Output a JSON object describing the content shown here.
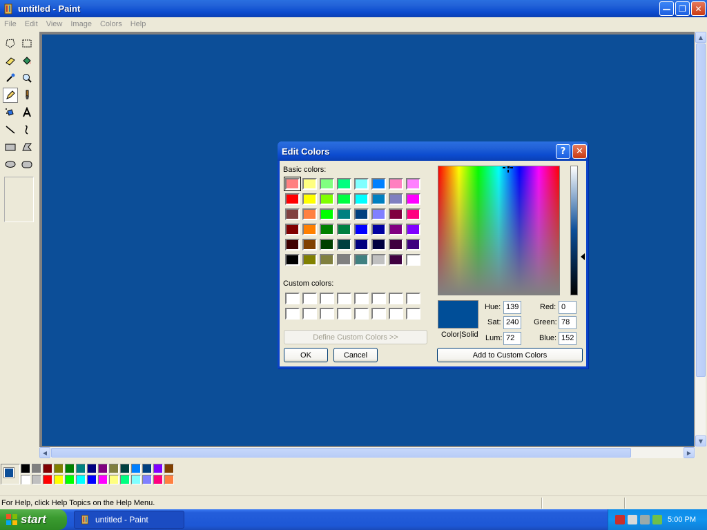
{
  "window": {
    "title": "untitled - Paint"
  },
  "menu": [
    "File",
    "Edit",
    "View",
    "Image",
    "Colors",
    "Help"
  ],
  "status": {
    "text": "For Help, click Help Topics on the Help Menu."
  },
  "taskbar": {
    "start_label": "start",
    "task_label": "untitled - Paint",
    "clock": "5:00 PM"
  },
  "palette": {
    "foreground": "#0c4e98",
    "background": "#ffffff",
    "row1": [
      "#000000",
      "#808080",
      "#800000",
      "#808000",
      "#008000",
      "#008080",
      "#000080",
      "#800080",
      "#808040",
      "#004040",
      "#0080ff",
      "#004080",
      "#8000ff",
      "#804000"
    ],
    "row2": [
      "#ffffff",
      "#c0c0c0",
      "#ff0000",
      "#ffff00",
      "#00ff00",
      "#00ffff",
      "#0000ff",
      "#ff00ff",
      "#ffff80",
      "#00ff80",
      "#80ffff",
      "#8080ff",
      "#ff0080",
      "#ff8040"
    ]
  },
  "dialog": {
    "title": "Edit Colors",
    "basic_label": "Basic colors:",
    "custom_label": "Custom colors:",
    "define_button": "Define Custom Colors >>",
    "ok": "OK",
    "cancel": "Cancel",
    "add_button": "Add to Custom Colors",
    "preview_label": "Color|Solid",
    "hue_label": "Hue:",
    "hue": "139",
    "sat_label": "Sat:",
    "sat": "240",
    "lum_label": "Lum:",
    "lum": "72",
    "red_label": "Red:",
    "red": "0",
    "green_label": "Green:",
    "green": "78",
    "blue_label": "Blue:",
    "blue": "152",
    "current_color": "#004e98",
    "basic_colors": [
      [
        "#ff8080",
        "#ffff80",
        "#80ff80",
        "#00ff80",
        "#80ffff",
        "#0080ff",
        "#ff80c0",
        "#ff80ff"
      ],
      [
        "#ff0000",
        "#ffff00",
        "#80ff00",
        "#00ff40",
        "#00ffff",
        "#0080c0",
        "#8080c0",
        "#ff00ff"
      ],
      [
        "#804040",
        "#ff8040",
        "#00ff00",
        "#008080",
        "#004080",
        "#8080ff",
        "#800040",
        "#ff0080"
      ],
      [
        "#800000",
        "#ff8000",
        "#008000",
        "#008040",
        "#0000ff",
        "#0000a0",
        "#800080",
        "#8000ff"
      ],
      [
        "#400000",
        "#804000",
        "#004000",
        "#004040",
        "#000080",
        "#000040",
        "#400040",
        "#400080"
      ],
      [
        "#000000",
        "#808000",
        "#808040",
        "#808080",
        "#408080",
        "#c0c0c0",
        "#400040",
        "#ffffff"
      ]
    ]
  }
}
